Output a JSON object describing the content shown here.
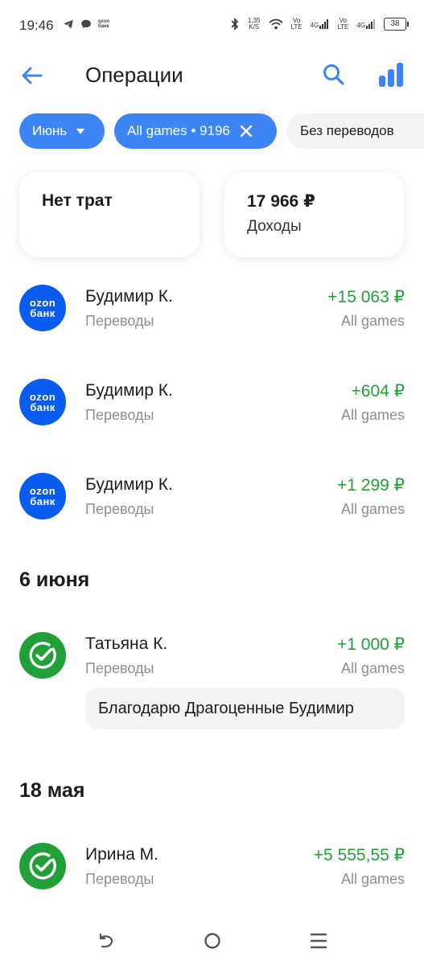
{
  "status_bar": {
    "time": "19:46",
    "network_speed": "1,35\nK/S",
    "vo1": "Vo\nLTE",
    "net1": "4G",
    "vo2": "Vo\nLTE",
    "net2": "4G",
    "battery": "38",
    "ozon_mini": "ozon\nбанк"
  },
  "header": {
    "title": "Операции",
    "back_icon": "arrow-left-icon",
    "search_icon": "search-icon",
    "stats_icon": "bar-chart-icon",
    "accent_color": "#3d85f5"
  },
  "filters": {
    "month": "Июнь",
    "account": "All games • 9196",
    "transfers": "Без переводов"
  },
  "summary": {
    "spend_title": "Нет трат",
    "income_amount": "17 966 ₽",
    "income_label": "Доходы"
  },
  "transactions": [
    {
      "name": "Будимир К.",
      "category": "Переводы",
      "amount": "+15 063 ₽",
      "account": "All games",
      "avatar": "ozon-bank-logo"
    },
    {
      "name": "Будимир К.",
      "category": "Переводы",
      "amount": "+604 ₽",
      "account": "All games",
      "avatar": "ozon-bank-logo"
    },
    {
      "name": "Будимир К.",
      "category": "Переводы",
      "amount": "+1 299 ₽",
      "account": "All games",
      "avatar": "ozon-bank-logo"
    }
  ],
  "groups": [
    {
      "date": "6 июня",
      "transaction": {
        "name": "Татьяна К.",
        "category": "Переводы",
        "amount": "+1 000 ₽",
        "account": "All games",
        "avatar": "sber-logo",
        "comment": "Благодарю Драгоценные Будимир"
      }
    },
    {
      "date": "18 мая",
      "transaction": {
        "name": "Ирина М.",
        "category": "Переводы",
        "amount": "+5 555,55 ₽",
        "account": "All games",
        "avatar": "sber-logo"
      }
    }
  ],
  "ozon_logo": {
    "line1": "ozon",
    "line2": "банк"
  },
  "colors": {
    "income": "#21a038",
    "ozon": "#0a5bf0",
    "sber": "#21a038"
  }
}
